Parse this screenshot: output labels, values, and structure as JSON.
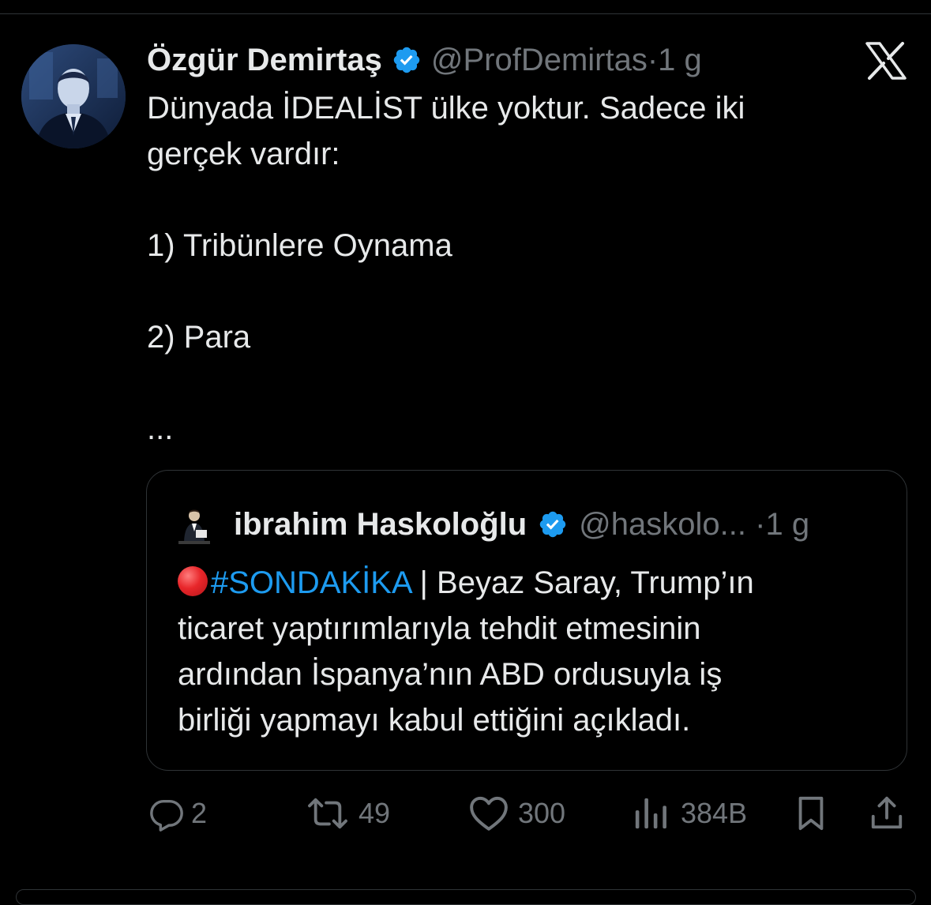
{
  "tweet": {
    "author_name": "Özgür Demirtaş",
    "handle": "@ProfDemirtas",
    "separator": "·",
    "time": "1 g",
    "text_lines": [
      "Dünyada İDEALİST ülke yoktur. Sadece iki",
      "gerçek vardır:",
      "",
      "1) Tribünlere Oynama",
      "",
      "2) Para",
      "",
      "..."
    ],
    "verified_color": "#1d9bf0"
  },
  "quote": {
    "author_name": "ibrahim Haskoloğlu",
    "handle": "@haskolo...",
    "separator": "·",
    "time": "1 g",
    "hashtag": "#SONDAKİKA",
    "text_after_hashtag": " | Beyaz Saray, Trump’ın",
    "text_lines": [
      "ticaret yaptırımlarıyla tehdit etmesinin",
      "ardından İspanya’nın ABD ordusuyla iş",
      "birliği yapmayı kabul ettiğini açıkladı."
    ],
    "hashtag_color": "#1d9bf0"
  },
  "actions": {
    "replies": "2",
    "reposts": "49",
    "likes": "300",
    "views": "384B"
  },
  "icons": {
    "app_logo": "x-logo-icon",
    "verified": "verified-badge-icon",
    "reply": "reply-icon",
    "repost": "repost-icon",
    "like": "heart-icon",
    "views": "views-icon",
    "bookmark": "bookmark-icon",
    "share": "share-icon"
  },
  "colors": {
    "background": "#000000",
    "text": "#e7e9ea",
    "muted": "#71767b",
    "accent": "#1d9bf0",
    "border": "#2f3336"
  }
}
